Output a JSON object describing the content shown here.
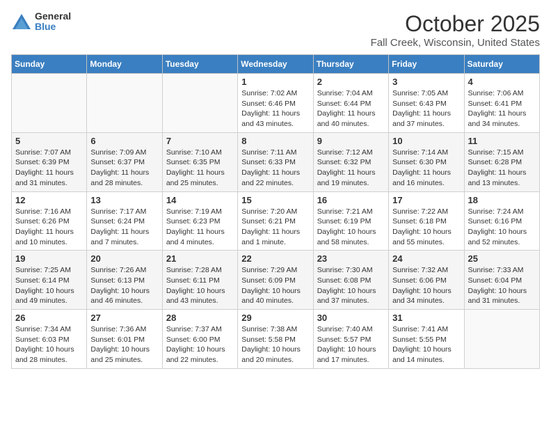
{
  "logo": {
    "general": "General",
    "blue": "Blue"
  },
  "title": "October 2025",
  "subtitle": "Fall Creek, Wisconsin, United States",
  "days_of_week": [
    "Sunday",
    "Monday",
    "Tuesday",
    "Wednesday",
    "Thursday",
    "Friday",
    "Saturday"
  ],
  "weeks": [
    [
      {
        "day": "",
        "info": ""
      },
      {
        "day": "",
        "info": ""
      },
      {
        "day": "",
        "info": ""
      },
      {
        "day": "1",
        "info": "Sunrise: 7:02 AM\nSunset: 6:46 PM\nDaylight: 11 hours\nand 43 minutes."
      },
      {
        "day": "2",
        "info": "Sunrise: 7:04 AM\nSunset: 6:44 PM\nDaylight: 11 hours\nand 40 minutes."
      },
      {
        "day": "3",
        "info": "Sunrise: 7:05 AM\nSunset: 6:43 PM\nDaylight: 11 hours\nand 37 minutes."
      },
      {
        "day": "4",
        "info": "Sunrise: 7:06 AM\nSunset: 6:41 PM\nDaylight: 11 hours\nand 34 minutes."
      }
    ],
    [
      {
        "day": "5",
        "info": "Sunrise: 7:07 AM\nSunset: 6:39 PM\nDaylight: 11 hours\nand 31 minutes."
      },
      {
        "day": "6",
        "info": "Sunrise: 7:09 AM\nSunset: 6:37 PM\nDaylight: 11 hours\nand 28 minutes."
      },
      {
        "day": "7",
        "info": "Sunrise: 7:10 AM\nSunset: 6:35 PM\nDaylight: 11 hours\nand 25 minutes."
      },
      {
        "day": "8",
        "info": "Sunrise: 7:11 AM\nSunset: 6:33 PM\nDaylight: 11 hours\nand 22 minutes."
      },
      {
        "day": "9",
        "info": "Sunrise: 7:12 AM\nSunset: 6:32 PM\nDaylight: 11 hours\nand 19 minutes."
      },
      {
        "day": "10",
        "info": "Sunrise: 7:14 AM\nSunset: 6:30 PM\nDaylight: 11 hours\nand 16 minutes."
      },
      {
        "day": "11",
        "info": "Sunrise: 7:15 AM\nSunset: 6:28 PM\nDaylight: 11 hours\nand 13 minutes."
      }
    ],
    [
      {
        "day": "12",
        "info": "Sunrise: 7:16 AM\nSunset: 6:26 PM\nDaylight: 11 hours\nand 10 minutes."
      },
      {
        "day": "13",
        "info": "Sunrise: 7:17 AM\nSunset: 6:24 PM\nDaylight: 11 hours\nand 7 minutes."
      },
      {
        "day": "14",
        "info": "Sunrise: 7:19 AM\nSunset: 6:23 PM\nDaylight: 11 hours\nand 4 minutes."
      },
      {
        "day": "15",
        "info": "Sunrise: 7:20 AM\nSunset: 6:21 PM\nDaylight: 11 hours\nand 1 minute."
      },
      {
        "day": "16",
        "info": "Sunrise: 7:21 AM\nSunset: 6:19 PM\nDaylight: 10 hours\nand 58 minutes."
      },
      {
        "day": "17",
        "info": "Sunrise: 7:22 AM\nSunset: 6:18 PM\nDaylight: 10 hours\nand 55 minutes."
      },
      {
        "day": "18",
        "info": "Sunrise: 7:24 AM\nSunset: 6:16 PM\nDaylight: 10 hours\nand 52 minutes."
      }
    ],
    [
      {
        "day": "19",
        "info": "Sunrise: 7:25 AM\nSunset: 6:14 PM\nDaylight: 10 hours\nand 49 minutes."
      },
      {
        "day": "20",
        "info": "Sunrise: 7:26 AM\nSunset: 6:13 PM\nDaylight: 10 hours\nand 46 minutes."
      },
      {
        "day": "21",
        "info": "Sunrise: 7:28 AM\nSunset: 6:11 PM\nDaylight: 10 hours\nand 43 minutes."
      },
      {
        "day": "22",
        "info": "Sunrise: 7:29 AM\nSunset: 6:09 PM\nDaylight: 10 hours\nand 40 minutes."
      },
      {
        "day": "23",
        "info": "Sunrise: 7:30 AM\nSunset: 6:08 PM\nDaylight: 10 hours\nand 37 minutes."
      },
      {
        "day": "24",
        "info": "Sunrise: 7:32 AM\nSunset: 6:06 PM\nDaylight: 10 hours\nand 34 minutes."
      },
      {
        "day": "25",
        "info": "Sunrise: 7:33 AM\nSunset: 6:04 PM\nDaylight: 10 hours\nand 31 minutes."
      }
    ],
    [
      {
        "day": "26",
        "info": "Sunrise: 7:34 AM\nSunset: 6:03 PM\nDaylight: 10 hours\nand 28 minutes."
      },
      {
        "day": "27",
        "info": "Sunrise: 7:36 AM\nSunset: 6:01 PM\nDaylight: 10 hours\nand 25 minutes."
      },
      {
        "day": "28",
        "info": "Sunrise: 7:37 AM\nSunset: 6:00 PM\nDaylight: 10 hours\nand 22 minutes."
      },
      {
        "day": "29",
        "info": "Sunrise: 7:38 AM\nSunset: 5:58 PM\nDaylight: 10 hours\nand 20 minutes."
      },
      {
        "day": "30",
        "info": "Sunrise: 7:40 AM\nSunset: 5:57 PM\nDaylight: 10 hours\nand 17 minutes."
      },
      {
        "day": "31",
        "info": "Sunrise: 7:41 AM\nSunset: 5:55 PM\nDaylight: 10 hours\nand 14 minutes."
      },
      {
        "day": "",
        "info": ""
      }
    ]
  ]
}
